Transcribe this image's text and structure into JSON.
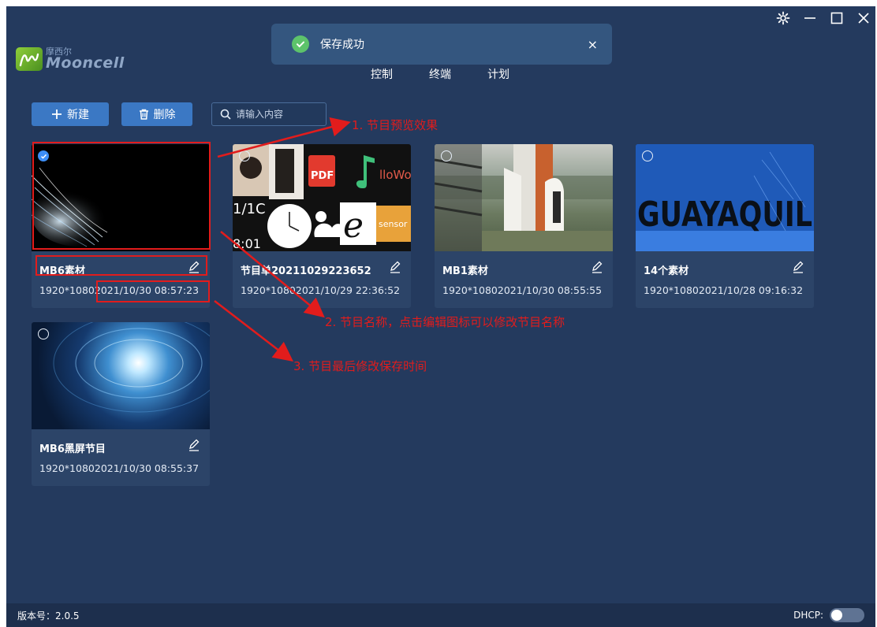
{
  "app": {
    "logo_cn": "摩西尔",
    "logo_en": "Mooncell",
    "nav": [
      "控制",
      "终端",
      "计划"
    ]
  },
  "toast": {
    "message": "保存成功",
    "close": "×"
  },
  "toolbar": {
    "new_label": "新建",
    "delete_label": "删除",
    "search_placeholder": "请输入内容"
  },
  "programs": [
    {
      "name": "MB6素材",
      "resolution": "1920*1080",
      "modified": "2021/10/30 08:57:23",
      "selected": true,
      "thumbnail": "black-particle"
    },
    {
      "name": "节目单20211029223652",
      "resolution": "1920*1080",
      "modified": "2021/10/29 22:36:52",
      "selected": false,
      "thumbnail": "multi-media"
    },
    {
      "name": "MB1素材",
      "resolution": "1920*1080",
      "modified": "2021/10/30 08:55:55",
      "selected": false,
      "thumbnail": "rocket"
    },
    {
      "name": "14个素材",
      "resolution": "1920*1080",
      "modified": "2021/10/28 09:16:32",
      "selected": false,
      "thumbnail": "guayaquil"
    },
    {
      "name": "MB6黑屏节目",
      "resolution": "1920*1080",
      "modified": "2021/10/30 08:55:37",
      "selected": false,
      "thumbnail": "space"
    }
  ],
  "thumb_text": {
    "multi_a": "1/1C",
    "multi_b": "8:01",
    "multi_hello": "lloWo",
    "pdf": "PDF",
    "sensor": "sensor",
    "guayaquil": "GUAYAQUIL"
  },
  "annotations": [
    "1. 节目预览效果",
    "2. 节目名称，点击编辑图标可以修改节目名称",
    "3. 节目最后修改保存时间"
  ],
  "status": {
    "version": "版本号：2.0.5",
    "dhcp_label": "DHCP:",
    "dhcp_enabled": false
  },
  "colors": {
    "background": "#243a5e",
    "card": "#2c4468",
    "button": "#3b78c4",
    "annotation": "#e21c1c",
    "success": "#5dc36b"
  }
}
